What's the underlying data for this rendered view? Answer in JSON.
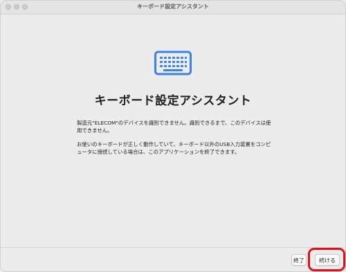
{
  "window": {
    "title": "キーボード設定アシスタント"
  },
  "main": {
    "icon": "keyboard-icon",
    "heading": "キーボード設定アシスタント",
    "paragraph1": "製造元\"ELECOM\"のデバイスを識別できません。識別できるまで、このデバイスは使用できません。",
    "paragraph2": "お使いのキーボードが正しく動作していて、キーボード以外のUSB入力装置をコンピュータに接続している場合は、このアプリケーションを終了できます。"
  },
  "footer": {
    "quit_label": "終了",
    "continue_label": "続ける"
  },
  "colors": {
    "accent": "#3b82e6",
    "highlight": "#e0101a"
  }
}
